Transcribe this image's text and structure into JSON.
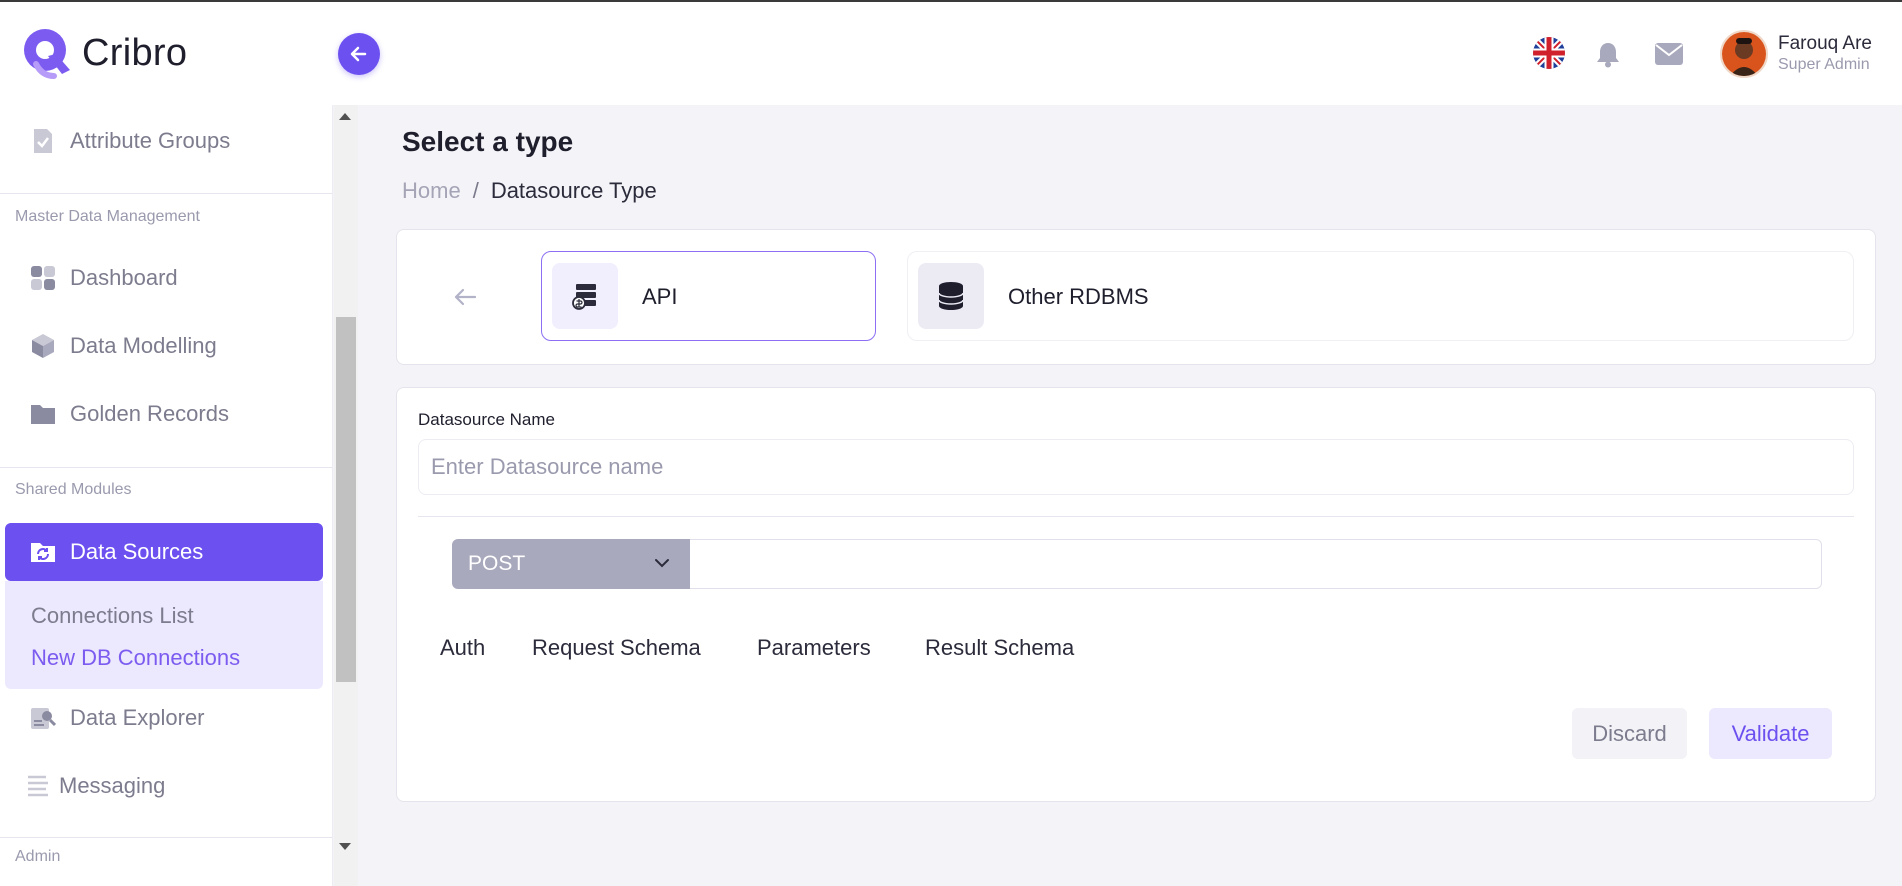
{
  "app": {
    "name": "Cribro",
    "accent_color": "#6c50f0"
  },
  "header": {
    "language_icon": "uk-flag-icon",
    "notifications_icon": "bell-icon",
    "messages_icon": "mail-icon",
    "user": {
      "name": "Farouq Are",
      "role": "Super Admin"
    }
  },
  "sidebar": {
    "top_items": [
      {
        "label": "Attribute Groups",
        "icon": "document-check-icon"
      }
    ],
    "sections": [
      {
        "title": "Master Data Management",
        "items": [
          {
            "label": "Dashboard",
            "icon": "grid-icon"
          },
          {
            "label": "Data Modelling",
            "icon": "cube-icon"
          },
          {
            "label": "Golden Records",
            "icon": "folder-icon"
          }
        ]
      },
      {
        "title": "Shared Modules",
        "active_item": {
          "label": "Data Sources",
          "icon": "folder-sync-icon"
        },
        "submenu": [
          {
            "label": "Connections List",
            "active": false
          },
          {
            "label": "New DB Connections",
            "active": true
          }
        ],
        "items": [
          {
            "label": "Data Explorer",
            "icon": "user-search-icon"
          },
          {
            "label": "Messaging",
            "icon": "lines-icon"
          }
        ]
      },
      {
        "title": "Admin"
      }
    ]
  },
  "main": {
    "title": "Select a type",
    "breadcrumb": {
      "home": "Home",
      "separator": "/",
      "current": "Datasource Type"
    },
    "type_options": [
      {
        "label": "API",
        "icon": "server-icon",
        "selected": true
      },
      {
        "label": "Other RDBMS",
        "icon": "database-icon",
        "selected": false
      }
    ],
    "form": {
      "datasource_label": "Datasource Name",
      "datasource_placeholder": "Enter Datasource name",
      "datasource_value": "",
      "method": "POST",
      "url_value": "",
      "tabs": [
        "Auth",
        "Request Schema",
        "Parameters",
        "Result Schema"
      ],
      "discard_label": "Discard",
      "validate_label": "Validate"
    }
  }
}
